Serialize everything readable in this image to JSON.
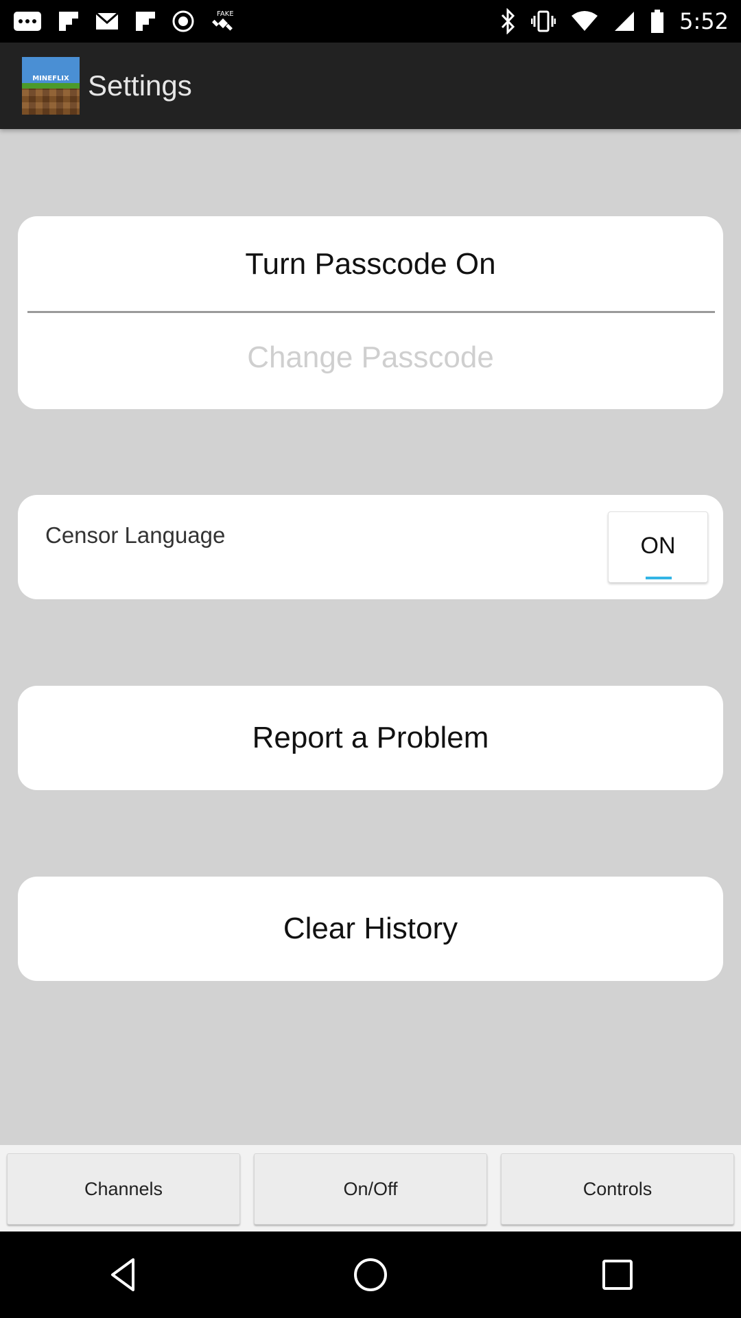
{
  "status_bar": {
    "time": "5:52",
    "left_icons": [
      "message-icon",
      "flipboard-icon",
      "email-icon",
      "flipboard-icon",
      "record-icon",
      "fake-gps-icon"
    ],
    "right_icons": [
      "bluetooth-icon",
      "vibrate-icon",
      "wifi-icon",
      "cell-signal-icon",
      "battery-icon"
    ]
  },
  "action_bar": {
    "logo_text": "MINEFLIX",
    "title": "Settings"
  },
  "passcode_card": {
    "turn_on_label": "Turn Passcode On",
    "change_label": "Change Passcode"
  },
  "censor_card": {
    "label": "Censor Language",
    "toggle_text": "ON",
    "toggle_state": true,
    "accent_color": "#33b5e5"
  },
  "report_label": "Report a Problem",
  "clear_label": "Clear History",
  "bottom_tabs": {
    "channels": "Channels",
    "onoff": "On/Off",
    "controls": "Controls"
  },
  "nav_bar": {
    "icons": [
      "back-icon",
      "home-icon",
      "recents-icon"
    ]
  }
}
